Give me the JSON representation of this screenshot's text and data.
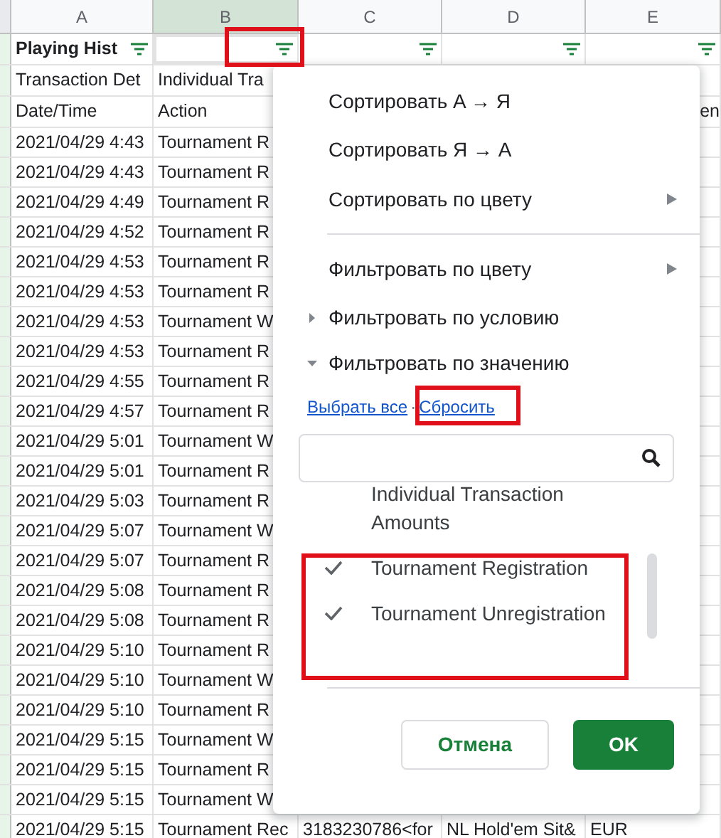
{
  "sheet": {
    "columns": [
      {
        "label": "A",
        "selected": false
      },
      {
        "label": "B",
        "selected": true
      },
      {
        "label": "C",
        "selected": false
      },
      {
        "label": "D",
        "selected": false
      },
      {
        "label": "E",
        "selected": false
      }
    ],
    "rows": [
      {
        "cells": [
          {
            "text": "Playing Hist",
            "bold": true,
            "filter": true
          },
          {
            "text": "",
            "filter": true,
            "selected": true
          },
          {
            "text": "",
            "filter": true
          },
          {
            "text": "",
            "filter": true
          },
          {
            "text": "",
            "filter": true
          }
        ]
      },
      {
        "cells": [
          {
            "text": "Transaction Det"
          },
          {
            "text": "Individual Tra"
          }
        ]
      },
      {
        "cells": [
          {
            "text": "Date/Time"
          },
          {
            "text": "Action"
          },
          {
            "text": ""
          },
          {
            "text": ""
          },
          {
            "text": "en"
          }
        ]
      },
      {
        "cells": [
          {
            "text": "2021/04/29 4:43"
          },
          {
            "text": "Tournament R"
          }
        ]
      },
      {
        "cells": [
          {
            "text": "2021/04/29 4:43"
          },
          {
            "text": "Tournament R"
          }
        ]
      },
      {
        "cells": [
          {
            "text": "2021/04/29 4:49"
          },
          {
            "text": "Tournament R"
          }
        ]
      },
      {
        "cells": [
          {
            "text": "2021/04/29 4:52"
          },
          {
            "text": "Tournament R"
          }
        ]
      },
      {
        "cells": [
          {
            "text": "2021/04/29 4:53"
          },
          {
            "text": "Tournament R"
          }
        ]
      },
      {
        "cells": [
          {
            "text": "2021/04/29 4:53"
          },
          {
            "text": "Tournament R"
          }
        ]
      },
      {
        "cells": [
          {
            "text": "2021/04/29 4:53"
          },
          {
            "text": "Tournament W"
          }
        ]
      },
      {
        "cells": [
          {
            "text": "2021/04/29 4:53"
          },
          {
            "text": "Tournament R"
          }
        ]
      },
      {
        "cells": [
          {
            "text": "2021/04/29 4:55"
          },
          {
            "text": "Tournament R"
          }
        ]
      },
      {
        "cells": [
          {
            "text": "2021/04/29 4:57"
          },
          {
            "text": "Tournament R"
          }
        ]
      },
      {
        "cells": [
          {
            "text": "2021/04/29 5:01"
          },
          {
            "text": "Tournament W"
          }
        ]
      },
      {
        "cells": [
          {
            "text": "2021/04/29 5:01"
          },
          {
            "text": "Tournament R"
          }
        ]
      },
      {
        "cells": [
          {
            "text": "2021/04/29 5:03"
          },
          {
            "text": "Tournament R"
          }
        ]
      },
      {
        "cells": [
          {
            "text": "2021/04/29 5:07"
          },
          {
            "text": "Tournament W"
          }
        ]
      },
      {
        "cells": [
          {
            "text": "2021/04/29 5:07"
          },
          {
            "text": "Tournament R"
          }
        ]
      },
      {
        "cells": [
          {
            "text": "2021/04/29 5:08"
          },
          {
            "text": "Tournament R"
          }
        ]
      },
      {
        "cells": [
          {
            "text": "2021/04/29 5:08"
          },
          {
            "text": "Tournament R"
          }
        ]
      },
      {
        "cells": [
          {
            "text": "2021/04/29 5:10"
          },
          {
            "text": "Tournament R"
          }
        ]
      },
      {
        "cells": [
          {
            "text": "2021/04/29 5:10"
          },
          {
            "text": "Tournament W"
          }
        ]
      },
      {
        "cells": [
          {
            "text": "2021/04/29 5:10"
          },
          {
            "text": "Tournament R"
          }
        ]
      },
      {
        "cells": [
          {
            "text": "2021/04/29 5:15"
          },
          {
            "text": "Tournament W"
          }
        ]
      },
      {
        "cells": [
          {
            "text": "2021/04/29 5:15"
          },
          {
            "text": "Tournament R"
          }
        ]
      },
      {
        "cells": [
          {
            "text": "2021/04/29 5:15"
          },
          {
            "text": "Tournament W"
          }
        ]
      },
      {
        "cells": [
          {
            "text": "2021/04/29 5:15"
          },
          {
            "text": "Tournament Rec"
          },
          {
            "text": "3183230786<for"
          },
          {
            "text": "NL Hold'em Sit&"
          },
          {
            "text": "EUR"
          }
        ]
      }
    ]
  },
  "filter_menu": {
    "items": [
      {
        "kind": "action",
        "label": "Сортировать A → Я"
      },
      {
        "kind": "action",
        "label": "Сортировать Я → A"
      },
      {
        "kind": "submenu",
        "label": "Сортировать по цвету"
      },
      {
        "kind": "divider"
      },
      {
        "kind": "submenu",
        "label": "Фильтровать по цвету"
      },
      {
        "kind": "section",
        "label": "Фильтровать по условию",
        "expanded": false
      },
      {
        "kind": "section",
        "label": "Фильтровать по значению",
        "expanded": true
      }
    ],
    "links": [
      "Выбрать все",
      "Сбросить"
    ],
    "link_separator": "·",
    "values": [
      {
        "label": "Individual Transaction Amounts",
        "checked": false
      },
      {
        "label": "Tournament Registration",
        "checked": true
      },
      {
        "label": "Tournament Unregistration",
        "checked": true
      }
    ],
    "buttons": [
      {
        "kind": "secondary",
        "label": "Отмена"
      },
      {
        "kind": "primary",
        "label": "OK"
      }
    ]
  }
}
